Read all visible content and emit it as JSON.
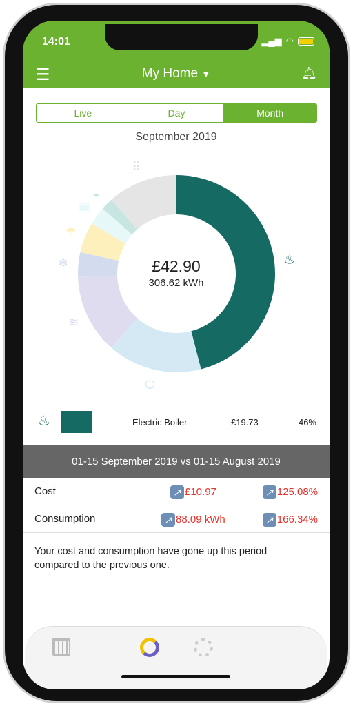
{
  "status_bar": {
    "time": "14:01"
  },
  "header": {
    "title": "My Home"
  },
  "tabs": [
    {
      "label": "Live"
    },
    {
      "label": "Day"
    },
    {
      "label": "Month",
      "active": true
    }
  ],
  "period": "September 2019",
  "total": {
    "cost": "£42.90",
    "energy": "306.62 kWh"
  },
  "chart_data": {
    "type": "pie",
    "donut": true,
    "slices": [
      {
        "name": "Electric Boiler",
        "value": 46,
        "color": "#156b64",
        "icon": "boiler-icon"
      },
      {
        "value": 15.5,
        "color": "#d4e9f4",
        "icon": "power-icon"
      },
      {
        "value": 13,
        "color": "#e0dcef",
        "icon": "heating-icon"
      },
      {
        "value": 4,
        "color": "#d2dcee",
        "icon": "snowflake-icon"
      },
      {
        "value": 5,
        "color": "#fdf0bd",
        "icon": "lamp-icon"
      },
      {
        "value": 3,
        "color": "#e6f8f8",
        "icon": "washing-machine-icon"
      },
      {
        "value": 2,
        "color": "#c7e6e2",
        "icon": "kettle-icon"
      },
      {
        "value": 11.5,
        "color": "#e5e5e5",
        "icon": "grid-icon"
      }
    ]
  },
  "legend": {
    "name": "Electric Boiler",
    "cost": "£19.73",
    "percent": "46%",
    "color": "#156b64"
  },
  "comparison": {
    "title": "01-15 September 2019 vs 01-15 August 2019",
    "rows": [
      {
        "label": "Cost",
        "value": "£10.97",
        "change": "125.08%"
      },
      {
        "label": "Consumption",
        "value": "88.09 kWh",
        "change": "166.34%"
      }
    ],
    "message": "Your cost and consumption have gone up this period compared to the previous one."
  },
  "colors": {
    "brand": "#6ab22f",
    "increase": "#e8332a"
  }
}
